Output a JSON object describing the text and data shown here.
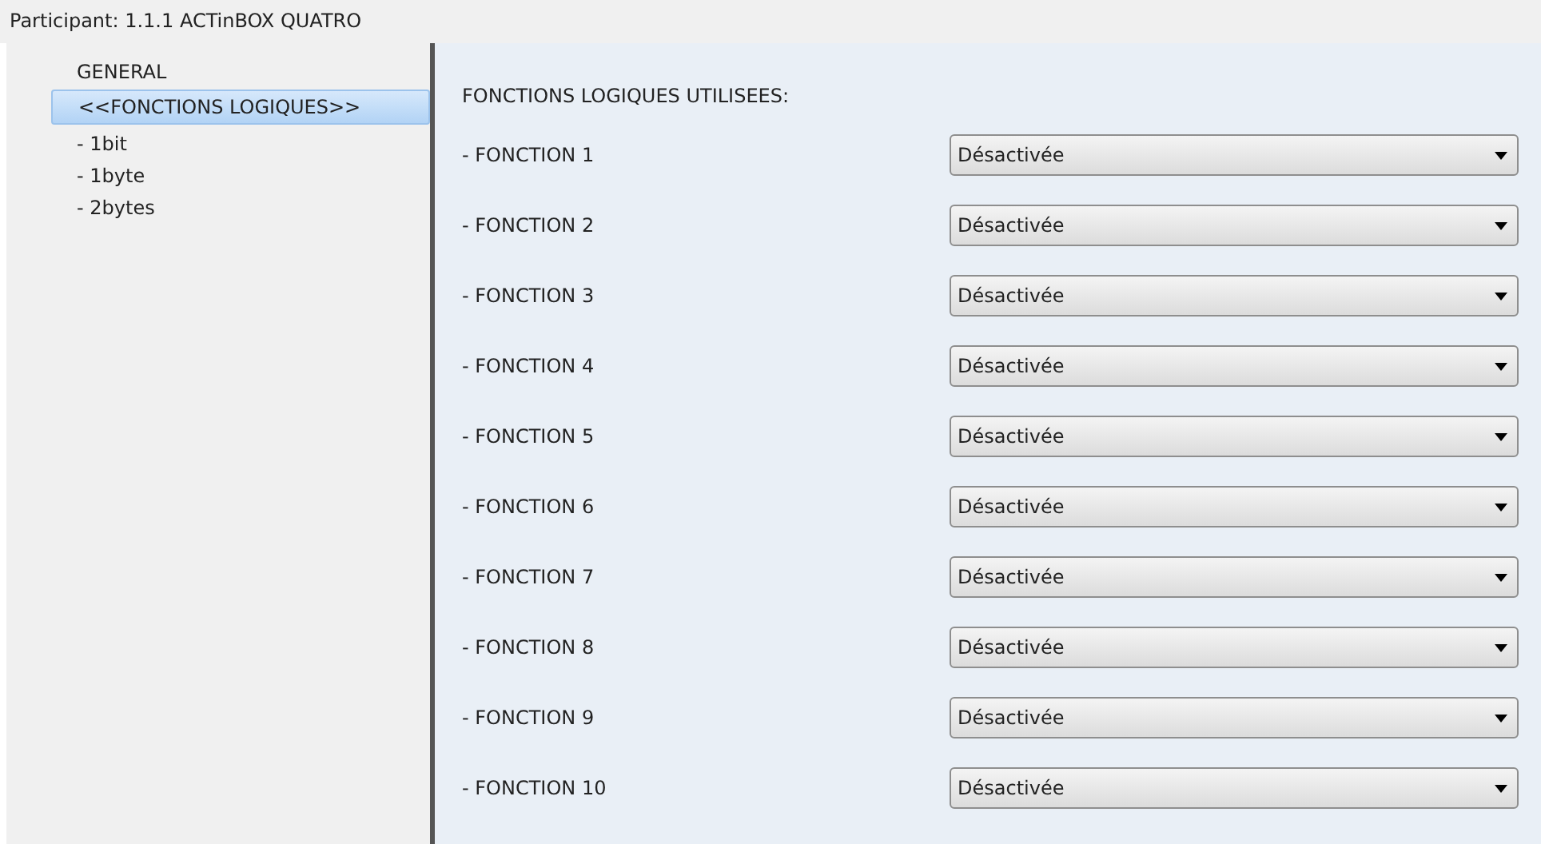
{
  "window": {
    "title": "Participant: 1.1.1  ACTinBOX QUATRO"
  },
  "sidebar": {
    "items": [
      {
        "label": "GENERAL",
        "selected": false
      },
      {
        "label": "<<FONCTIONS LOGIQUES>>",
        "selected": true
      },
      {
        "label": "- 1bit",
        "selected": false
      },
      {
        "label": "- 1byte",
        "selected": false
      },
      {
        "label": "- 2bytes",
        "selected": false
      }
    ]
  },
  "panel": {
    "heading": "FONCTIONS LOGIQUES UTILISEES:",
    "rows": [
      {
        "label": "- FONCTION 1",
        "value": "Désactivée"
      },
      {
        "label": "- FONCTION 2",
        "value": "Désactivée"
      },
      {
        "label": "- FONCTION 3",
        "value": "Désactivée"
      },
      {
        "label": "- FONCTION 4",
        "value": "Désactivée"
      },
      {
        "label": "- FONCTION 5",
        "value": "Désactivée"
      },
      {
        "label": "- FONCTION 6",
        "value": "Désactivée"
      },
      {
        "label": "- FONCTION 7",
        "value": "Désactivée"
      },
      {
        "label": "- FONCTION 8",
        "value": "Désactivée"
      },
      {
        "label": "- FONCTION 9",
        "value": "Désactivée"
      },
      {
        "label": "- FONCTION 10",
        "value": "Désactivée"
      }
    ]
  }
}
